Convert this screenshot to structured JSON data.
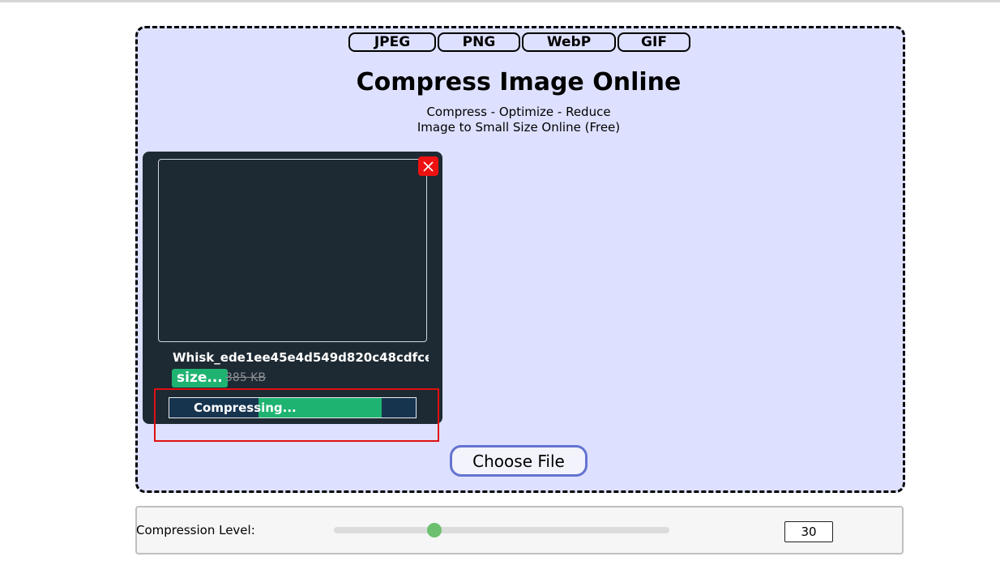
{
  "formats": {
    "tabs": [
      {
        "label": "JPEG"
      },
      {
        "label": "PNG"
      },
      {
        "label": "WebP"
      },
      {
        "label": "GIF"
      }
    ]
  },
  "hero": {
    "title": "Compress Image Online",
    "subtitle_line1": "Compress - Optimize - Reduce",
    "subtitle_line2": "Image to Small Size Online (Free)"
  },
  "file_card": {
    "filename": "Whisk_ede1ee45e4d549d820c48cdfce...",
    "new_size": "size...",
    "original_size": "385 KB",
    "close_icon": "close-icon",
    "progress": {
      "label": "Compressing...",
      "fraction": 0.79
    }
  },
  "upload": {
    "choose_label": "Choose File"
  },
  "settings": {
    "level_label": "Compression Level:",
    "level_value": "30",
    "level_fraction": 0.3
  },
  "colors": {
    "dropzone_bg": "#dde1ff",
    "card_bg": "#1e2a33",
    "accent_green": "#1fb371",
    "progress_bg": "#17344f",
    "close_red": "#ee1111",
    "highlight_red": "#e01010",
    "button_border": "#6473d0",
    "slider_thumb": "#6dc06f"
  }
}
